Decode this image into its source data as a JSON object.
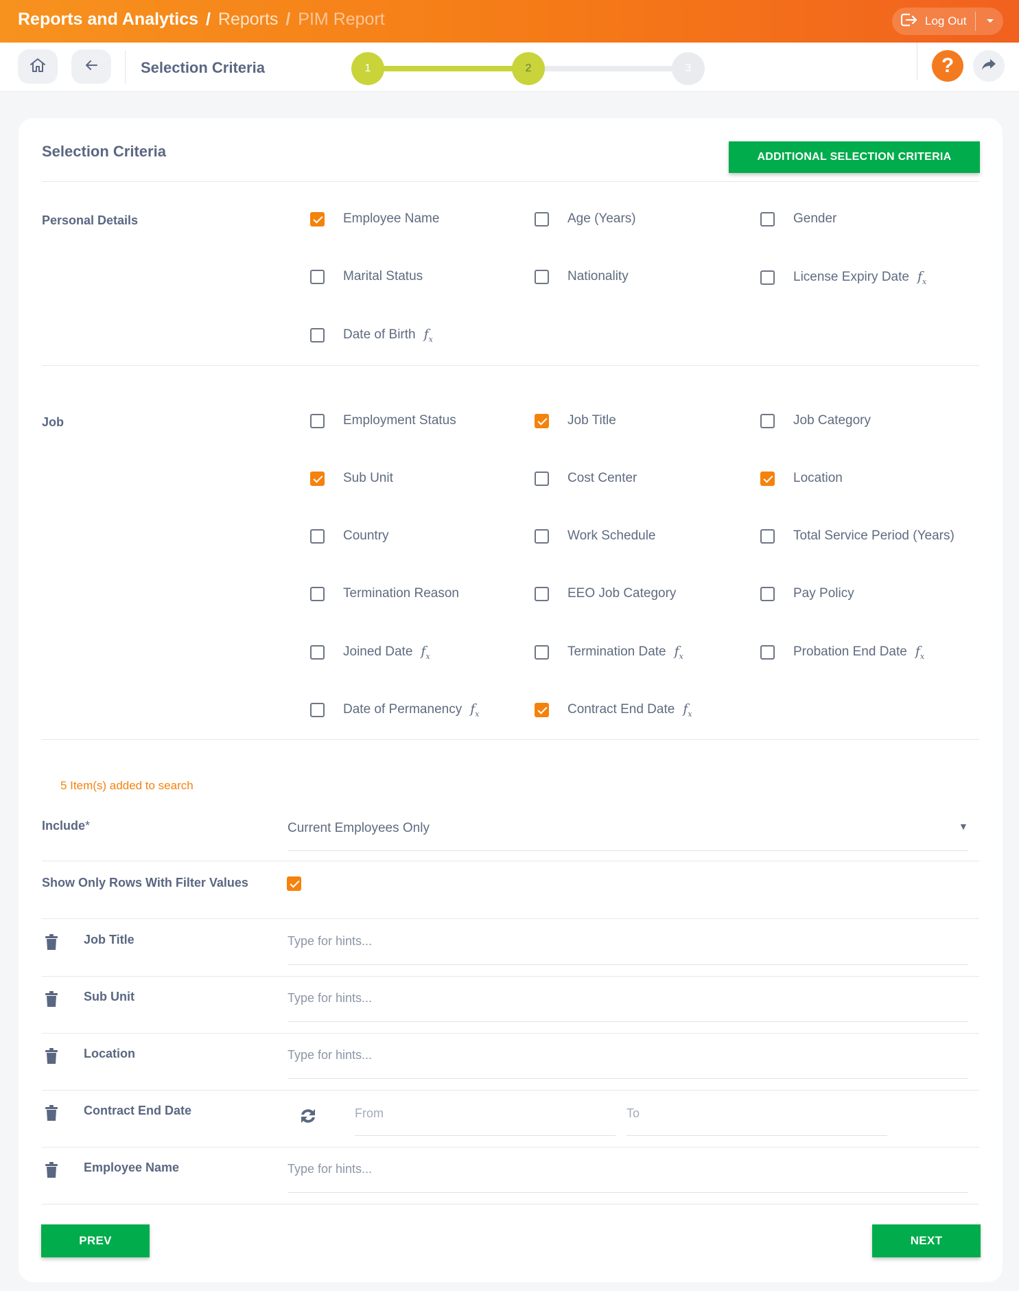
{
  "topbar": {
    "breadcrumb": [
      "Reports and Analytics",
      "Reports",
      "PIM Report"
    ],
    "separator": "/",
    "logout_label": "Log Out"
  },
  "header": {
    "title": "Selection Criteria",
    "steps": [
      "1",
      "2",
      "3"
    ],
    "help_label": "?"
  },
  "card": {
    "title": "Selection Criteria",
    "additional_button": "ADDITIONAL SELECTION CRITERIA"
  },
  "sections": {
    "personal": {
      "label": "Personal Details",
      "options": [
        {
          "label": "Employee Name",
          "checked": true,
          "fx": false
        },
        {
          "label": "Age (Years)",
          "checked": false,
          "fx": false
        },
        {
          "label": "Gender",
          "checked": false,
          "fx": false
        },
        {
          "label": "Marital Status",
          "checked": false,
          "fx": false
        },
        {
          "label": "Nationality",
          "checked": false,
          "fx": false
        },
        {
          "label": "License Expiry Date",
          "checked": false,
          "fx": true
        },
        {
          "label": "Date of Birth",
          "checked": false,
          "fx": true
        }
      ]
    },
    "job": {
      "label": "Job",
      "options": [
        {
          "label": "Employment Status",
          "checked": false,
          "fx": false
        },
        {
          "label": "Job Title",
          "checked": true,
          "fx": false
        },
        {
          "label": "Job Category",
          "checked": false,
          "fx": false
        },
        {
          "label": "Sub Unit",
          "checked": true,
          "fx": false
        },
        {
          "label": "Cost Center",
          "checked": false,
          "fx": false
        },
        {
          "label": "Location",
          "checked": true,
          "fx": false
        },
        {
          "label": "Country",
          "checked": false,
          "fx": false
        },
        {
          "label": "Work Schedule",
          "checked": false,
          "fx": false
        },
        {
          "label": "Total Service Period (Years)",
          "checked": false,
          "fx": false
        },
        {
          "label": "Termination Reason",
          "checked": false,
          "fx": false
        },
        {
          "label": "EEO Job Category",
          "checked": false,
          "fx": false
        },
        {
          "label": "Pay Policy",
          "checked": false,
          "fx": false
        },
        {
          "label": "Joined Date",
          "checked": false,
          "fx": true
        },
        {
          "label": "Termination Date",
          "checked": false,
          "fx": true
        },
        {
          "label": "Probation End Date",
          "checked": false,
          "fx": true
        },
        {
          "label": "Date of Permanency",
          "checked": false,
          "fx": true
        },
        {
          "label": "Contract End Date",
          "checked": true,
          "fx": true
        }
      ]
    }
  },
  "fx_symbol": "f",
  "fx_sub": "x",
  "summary": {
    "count_text": "5 Item(s) added to search",
    "include_label": "Include",
    "include_required": "*",
    "include_value": "Current Employees Only",
    "include_caret": "▼",
    "show_rows_label": "Show Only Rows With Filter Values",
    "show_rows_checked": true
  },
  "filters": {
    "hint_placeholder": "Type for hints...",
    "rows": [
      {
        "label": "Job Title",
        "type": "hint"
      },
      {
        "label": "Sub Unit",
        "type": "hint"
      },
      {
        "label": "Location",
        "type": "hint"
      },
      {
        "label": "Contract End Date",
        "type": "range",
        "from_placeholder": "From",
        "to_placeholder": "To"
      },
      {
        "label": "Employee Name",
        "type": "hint"
      }
    ]
  },
  "footer": {
    "prev_label": "PREV",
    "next_label": "NEXT"
  },
  "colors": {
    "topbar_orange": "#f57a17",
    "accent_orange": "#f5820c",
    "step_done": "#c8d43a",
    "step_pending": "#e6e8ec",
    "green_button": "#00ac4b"
  }
}
